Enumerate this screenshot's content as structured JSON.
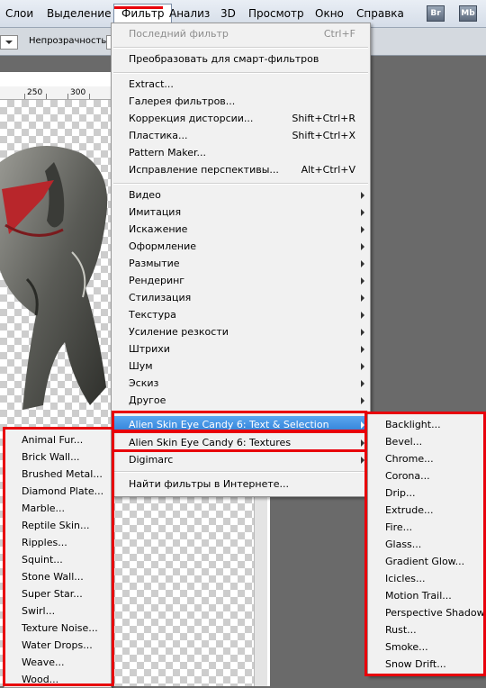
{
  "menubar": {
    "items": [
      "Слои",
      "Выделение",
      "Фильтр",
      "Анализ",
      "3D",
      "Просмотр",
      "Окно",
      "Справка"
    ],
    "app_icons": [
      "Br",
      "Mb"
    ]
  },
  "options_bar": {
    "opacity_label": "Непрозрачность:"
  },
  "ruler": {
    "labels": [
      "250",
      "300"
    ]
  },
  "filter_menu": {
    "items": [
      {
        "label": "Последний фильтр",
        "shortcut": "Ctrl+F",
        "disabled": true
      },
      {
        "label": "Преобразовать для смарт-фильтров"
      },
      {
        "label": "Extract..."
      },
      {
        "label": "Галерея фильтров..."
      },
      {
        "label": "Коррекция дисторсии...",
        "shortcut": "Shift+Ctrl+R"
      },
      {
        "label": "Пластика...",
        "shortcut": "Shift+Ctrl+X"
      },
      {
        "label": "Pattern Maker..."
      },
      {
        "label": "Исправление перспективы...",
        "shortcut": "Alt+Ctrl+V"
      },
      {
        "label": "Видео",
        "submenu": true
      },
      {
        "label": "Имитация",
        "submenu": true
      },
      {
        "label": "Искажение",
        "submenu": true
      },
      {
        "label": "Оформление",
        "submenu": true
      },
      {
        "label": "Размытие",
        "submenu": true
      },
      {
        "label": "Рендеринг",
        "submenu": true
      },
      {
        "label": "Стилизация",
        "submenu": true
      },
      {
        "label": "Текстура",
        "submenu": true
      },
      {
        "label": "Усиление резкости",
        "submenu": true
      },
      {
        "label": "Штрихи",
        "submenu": true
      },
      {
        "label": "Шум",
        "submenu": true
      },
      {
        "label": "Эскиз",
        "submenu": true
      },
      {
        "label": "Другое",
        "submenu": true
      },
      {
        "label": "Alien Skin Eye Candy 6: Text & Selection",
        "submenu": true,
        "highlighted": true
      },
      {
        "label": "Alien Skin Eye Candy 6: Textures",
        "submenu": true
      },
      {
        "label": "Digimarc",
        "submenu": true
      },
      {
        "label": "Найти фильтры в Интернете..."
      }
    ]
  },
  "text_selection_submenu": {
    "items": [
      "Backlight...",
      "Bevel...",
      "Chrome...",
      "Corona...",
      "Drip...",
      "Extrude...",
      "Fire...",
      "Glass...",
      "Gradient Glow...",
      "Icicles...",
      "Motion Trail...",
      "Perspective Shadow...",
      "Rust...",
      "Smoke...",
      "Snow Drift..."
    ]
  },
  "textures_submenu": {
    "items": [
      "Animal Fur...",
      "Brick Wall...",
      "Brushed Metal...",
      "Diamond Plate...",
      "Marble...",
      "Reptile Skin...",
      "Ripples...",
      "Squint...",
      "Stone Wall...",
      "Super Star...",
      "Swirl...",
      "Texture Noise...",
      "Water Drops...",
      "Weave...",
      "Wood..."
    ]
  },
  "colors": {
    "accent_highlight": "#3b8ee6",
    "annotation_red": "#e8000b"
  }
}
